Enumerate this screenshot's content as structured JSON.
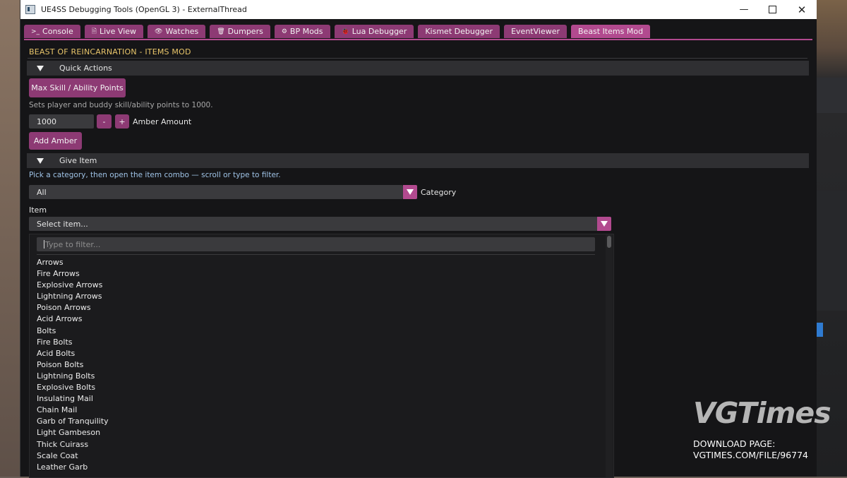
{
  "window": {
    "title": "UE4SS Debugging Tools (OpenGL 3) - ExternalThread"
  },
  "tabs": [
    {
      "icon": "terminal-icon",
      "glyph": ">_",
      "label": "Console"
    },
    {
      "icon": "document-icon",
      "glyph": "🗎",
      "label": "Live View"
    },
    {
      "icon": "eye-icon",
      "glyph": "👁",
      "label": "Watches"
    },
    {
      "icon": "trash-icon",
      "glyph": "🗑",
      "label": "Dumpers"
    },
    {
      "icon": "blueprint-icon",
      "glyph": "⚙",
      "label": "BP Mods"
    },
    {
      "icon": "bug-icon",
      "glyph": "🐞",
      "label": "Lua Debugger"
    },
    {
      "icon": "",
      "glyph": "",
      "label": "Kismet Debugger"
    },
    {
      "icon": "",
      "glyph": "",
      "label": "EventViewer"
    },
    {
      "icon": "",
      "glyph": "",
      "label": "Beast Items Mod",
      "active": true
    }
  ],
  "mod_title": "BEAST OF REINCARNATION - ITEMS MOD",
  "quick_actions": {
    "header": "Quick Actions",
    "max_button": "Max Skill / Ability Points",
    "hint": "Sets player and buddy skill/ability points to 1000.",
    "amber_value": "1000",
    "minus": "-",
    "plus": "+",
    "amber_label": "Amber Amount",
    "add_amber": "Add Amber"
  },
  "give_item": {
    "header": "Give Item",
    "hint": "Pick a category, then open the item combo — scroll or type to filter.",
    "category_value": "All",
    "category_label": "Category",
    "item_label": "Item",
    "item_value": "Select item...",
    "filter_placeholder": "Type to filter...",
    "items": [
      "Arrows",
      "Fire Arrows",
      "Explosive Arrows",
      "Lightning Arrows",
      "Poison Arrows",
      "Acid Arrows",
      "Bolts",
      "Fire Bolts",
      "Acid Bolts",
      "Poison Bolts",
      "Lightning Bolts",
      "Explosive Bolts",
      "Insulating Mail",
      "Chain Mail",
      "Garb of Tranquility",
      "Light Gambeson",
      "Thick Cuirass",
      "Scale Coat",
      "Leather Garb"
    ]
  },
  "watermark": {
    "logo": "VGTimes",
    "line1": "DOWNLOAD PAGE:",
    "line2": "VGTIMES.COM/FILE/96774"
  }
}
